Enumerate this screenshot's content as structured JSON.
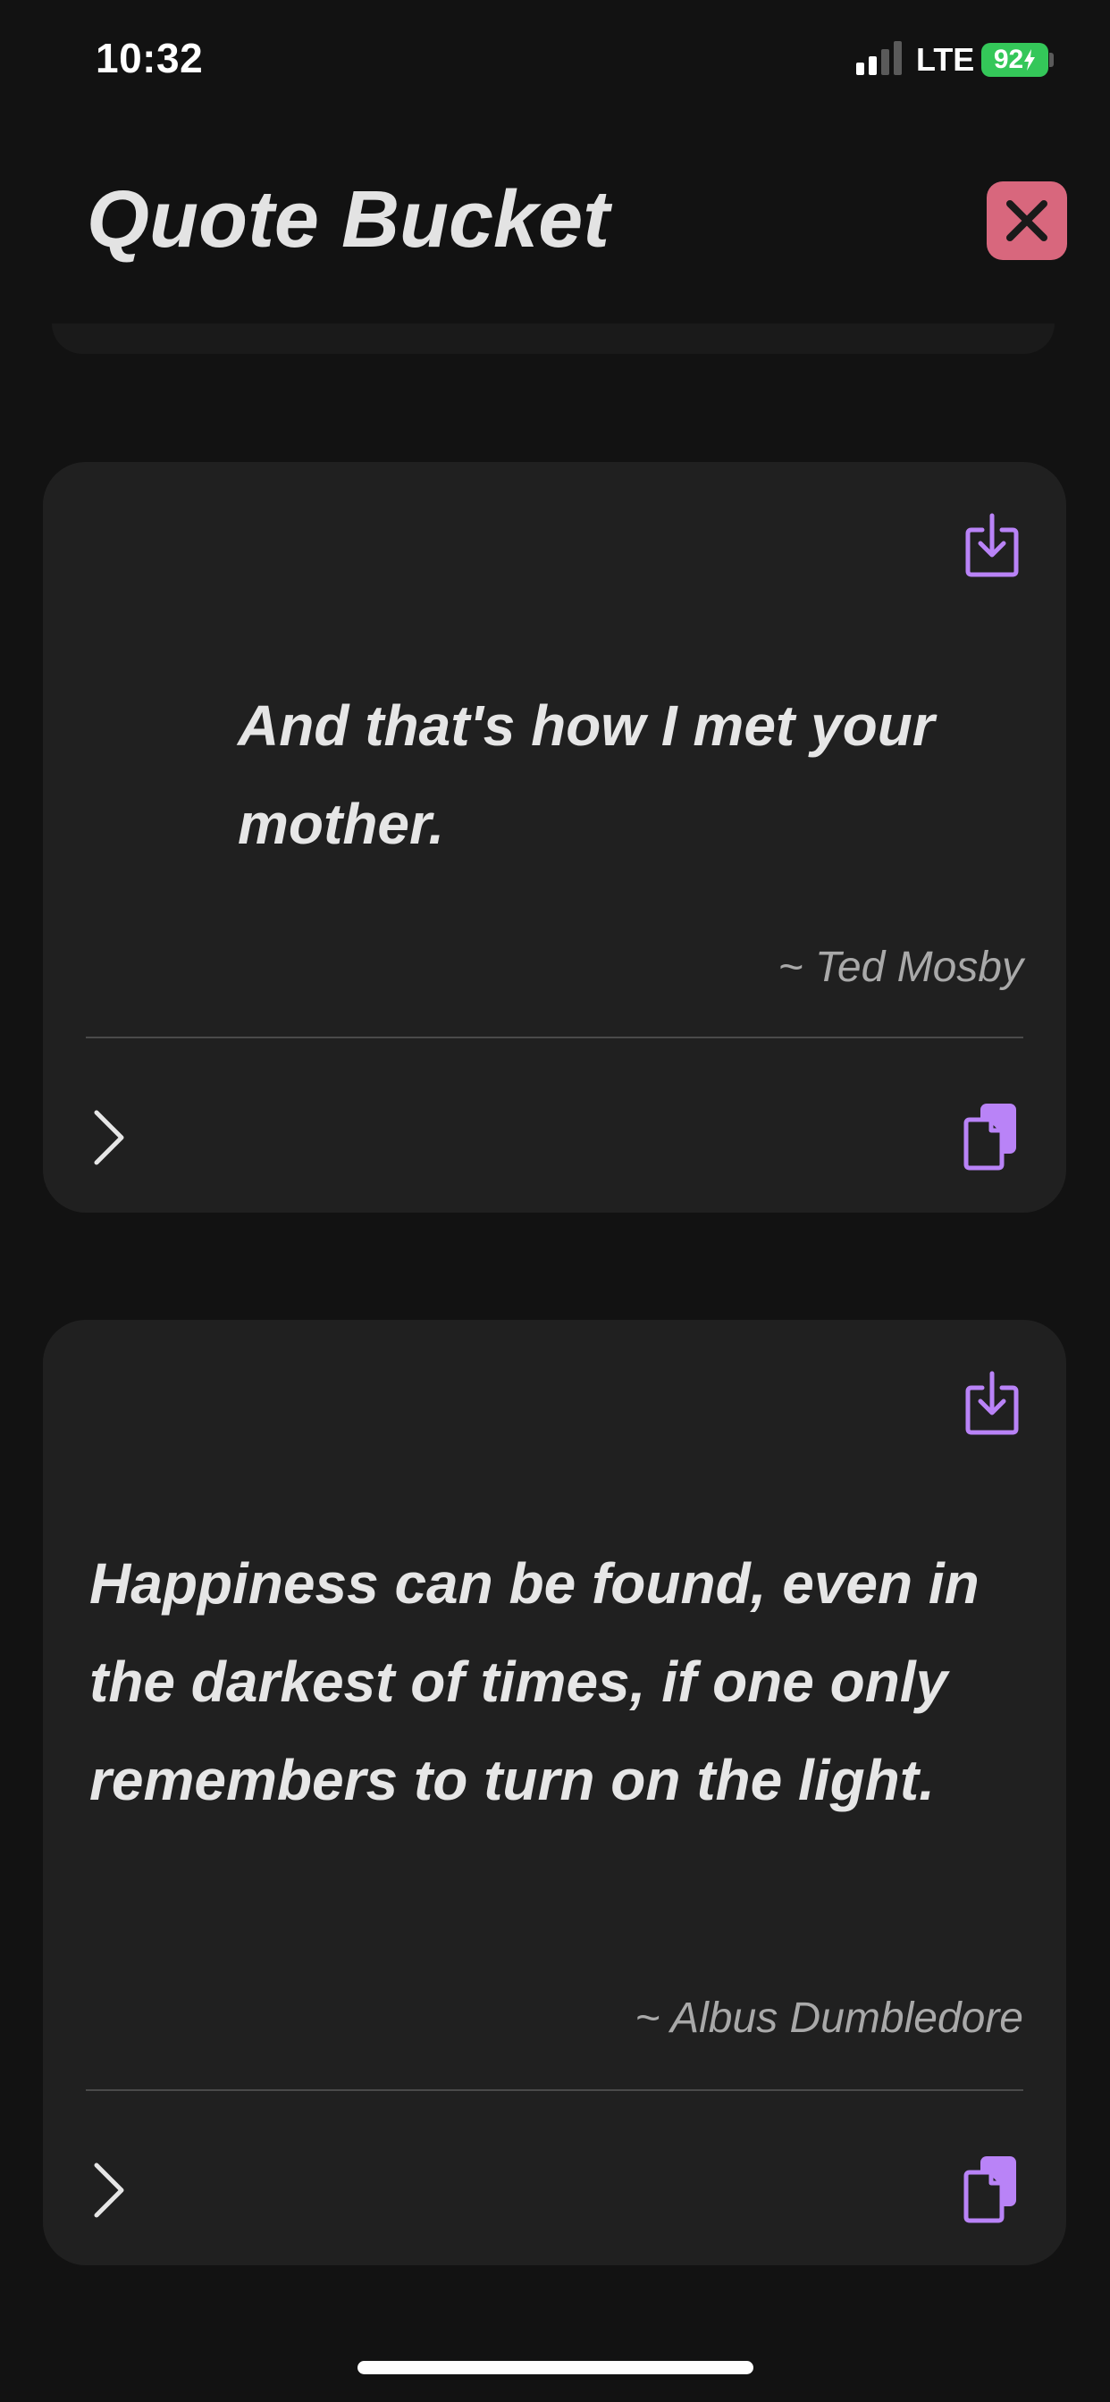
{
  "status_bar": {
    "time": "10:32",
    "network": "LTE",
    "battery": "92"
  },
  "header": {
    "title": "Quote Bucket",
    "close_icon": "close-x-icon"
  },
  "colors": {
    "accent": "#b983f7",
    "close_bg": "#d8677d",
    "battery": "#34c759",
    "card_bg": "#202020",
    "page_bg": "#121212"
  },
  "quotes": [
    {
      "text": "And that's how I met your mother.",
      "author": "~ Ted Mosby"
    },
    {
      "text": "Happiness can be found, even in the darkest of times, if one only remembers to turn on the light.",
      "author": "~ Albus Dumbledore"
    }
  ]
}
